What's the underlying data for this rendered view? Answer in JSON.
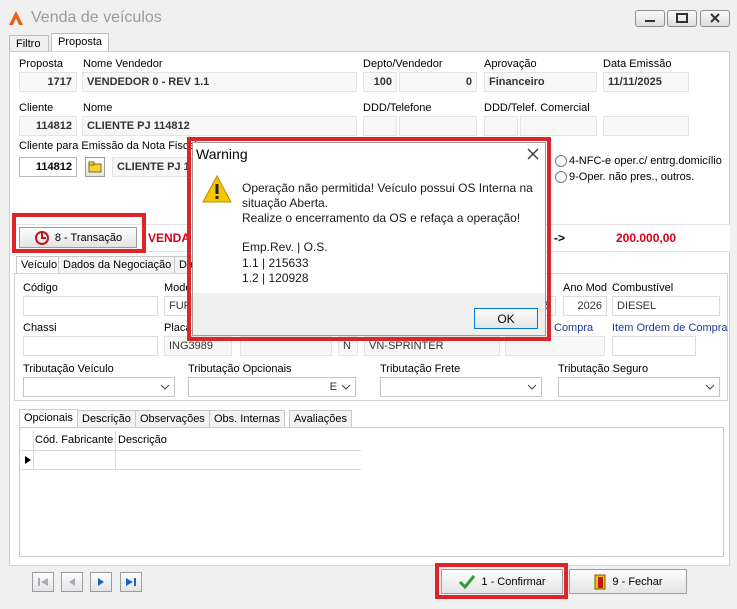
{
  "window": {
    "title": "Venda de veículos"
  },
  "tabs": [
    {
      "label": "Filtro"
    },
    {
      "label": "Proposta"
    }
  ],
  "header": {
    "proposta_label": "Proposta",
    "proposta_value": "1717",
    "vendedor_label": "Nome Vendedor",
    "vendedor_value": "VENDEDOR 0 - REV 1.1",
    "depto_label": "Depto/Vendedor",
    "depto_value": "100",
    "vend_value": "0",
    "aprovacao_label": "Aprovação",
    "aprovacao_value": "Financeiro",
    "data_label": "Data Emissão",
    "data_value": "11/11/2025",
    "cliente_label": "Cliente",
    "cliente_value": "114812",
    "nome_label": "Nome",
    "nome_value": "CLIENTE PJ 114812",
    "ddd_tel_label": "DDD/Telefone",
    "ddd_com_label": "DDD/Telef. Comercial",
    "cliente_nf_label": "Cliente para Emissão da Nota Fiscal",
    "cliente_nf_value": "114812",
    "cliente_nf_name": "CLIENTE PJ 1",
    "radio1": "4-NFC-e oper.c/ entrg.domicílio",
    "radio2": "9-Oper. não pres., outros."
  },
  "transacao": {
    "button_label": "8 - Transação",
    "venda_label": "VENDA",
    "arrow": "->",
    "total": "200.000,00"
  },
  "vehicle_tabs": [
    {
      "label": "Veículo"
    },
    {
      "label": "Dados da Negociação"
    },
    {
      "label": "Da"
    }
  ],
  "vehicle": {
    "codigo_label": "Código",
    "modelo_label": "Mode",
    "modelo_value": "FURG",
    "ano_fab_value": "5",
    "ano_mod_label": "Ano Mod",
    "ano_mod_value": "2026",
    "combustivel_label": "Combustível",
    "combustivel_value": "DIESEL",
    "chassi_label": "Chassi",
    "placa_label": "Placa",
    "placa_value": "ING3989",
    "n_value": "N",
    "vn_value": "VN-SPRINTER",
    "compra_label": "Compra",
    "item_ordem_label": "Item Ordem de Compra",
    "trib_veiculo_label": "Tributação Veículo",
    "trib_veiculo_value": "",
    "trib_opc_label": "Tributação Opcionais",
    "trib_opc_value": "E",
    "trib_frete_label": "Tributação Frete",
    "trib_seguro_label": "Tributação Seguro"
  },
  "sub_tabs": [
    {
      "label": "Opcionais"
    },
    {
      "label": "Descrição"
    },
    {
      "label": "Observações"
    },
    {
      "label": "Obs. Internas"
    },
    {
      "label": "Avaliações"
    }
  ],
  "grid": {
    "columns": [
      "Cód. Fabricante",
      "Descrição"
    ]
  },
  "footer": {
    "confirm_label": "1 - Confirmar",
    "close_label": "9 - Fechar"
  },
  "dialog": {
    "title": "Warning",
    "line1": "Operação não permitida! Veículo possui OS Interna na",
    "line2": "situação Aberta.",
    "line3": "Realize o encerramento da OS e refaça a operação!",
    "line4": "Emp.Rev. | O.S.",
    "line5": "1.1 | 215633",
    "line6": "1.2 | 120928",
    "ok_label": "OK"
  },
  "colors": {
    "highlight_red": "#e0232a",
    "link_blue": "#1f3a93",
    "venda_red": "#d0021b"
  }
}
